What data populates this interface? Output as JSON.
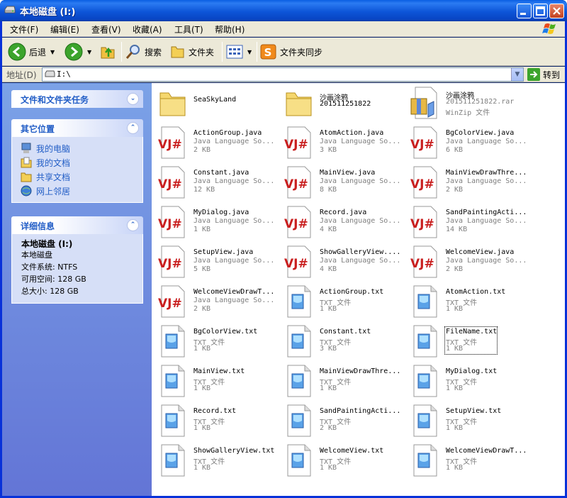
{
  "window": {
    "title": "本地磁盘 (I:)"
  },
  "menu": [
    "文件(F)",
    "编辑(E)",
    "查看(V)",
    "收藏(A)",
    "工具(T)",
    "帮助(H)"
  ],
  "toolbar": {
    "back_label": "后退",
    "search_label": "搜索",
    "folders_label": "文件夹",
    "sync_label": "文件夹同步"
  },
  "address": {
    "label": "地址(D)",
    "value": "I:\\",
    "go_label": "转到"
  },
  "left_panel": {
    "tasks_title": "文件和文件夹任务",
    "other_title": "其它位置",
    "other_links": [
      "我的电脑",
      "我的文档",
      "共享文档",
      "网上邻居"
    ],
    "details_title": "详细信息",
    "details": {
      "name": "本地磁盘 (I:)",
      "type": "本地磁盘",
      "fs": "文件系统: NTFS",
      "free": "可用空间: 128 GB",
      "total": "总大小: 128 GB"
    }
  },
  "files": [
    {
      "l1": "SeaSkyLand",
      "l2": "",
      "l3": "",
      "icon": "folder"
    },
    {
      "l1": "沙画涂鸦",
      "l2": "201511251822",
      "l3": "",
      "icon": "folder"
    },
    {
      "l1": "沙画涂鸦",
      "l2": "201511251822.rar",
      "l3": "WinZip 文件",
      "icon": "zip"
    },
    {
      "l1": "ActionGroup.java",
      "l2": "Java Language So...",
      "l3": "2 KB",
      "icon": "java"
    },
    {
      "l1": "AtomAction.java",
      "l2": "Java Language So...",
      "l3": "3 KB",
      "icon": "java"
    },
    {
      "l1": "BgColorView.java",
      "l2": "Java Language So...",
      "l3": "6 KB",
      "icon": "java"
    },
    {
      "l1": "Constant.java",
      "l2": "Java Language So...",
      "l3": "12 KB",
      "icon": "java"
    },
    {
      "l1": "MainView.java",
      "l2": "Java Language So...",
      "l3": "8 KB",
      "icon": "java"
    },
    {
      "l1": "MainViewDrawThre...",
      "l2": "Java Language So...",
      "l3": "2 KB",
      "icon": "java"
    },
    {
      "l1": "MyDialog.java",
      "l2": "Java Language So...",
      "l3": "1 KB",
      "icon": "java"
    },
    {
      "l1": "Record.java",
      "l2": "Java Language So...",
      "l3": "4 KB",
      "icon": "java"
    },
    {
      "l1": "SandPaintingActi...",
      "l2": "Java Language So...",
      "l3": "14 KB",
      "icon": "java"
    },
    {
      "l1": "SetupView.java",
      "l2": "Java Language So...",
      "l3": "5 KB",
      "icon": "java"
    },
    {
      "l1": "ShowGalleryView....",
      "l2": "Java Language So...",
      "l3": "4 KB",
      "icon": "java"
    },
    {
      "l1": "WelcomeView.java",
      "l2": "Java Language So...",
      "l3": "2 KB",
      "icon": "java"
    },
    {
      "l1": "WelcomeViewDrawT...",
      "l2": "Java Language So...",
      "l3": "2 KB",
      "icon": "java"
    },
    {
      "l1": "ActionGroup.txt",
      "l2": "TXT 文件",
      "l3": "1 KB",
      "icon": "txt"
    },
    {
      "l1": "AtomAction.txt",
      "l2": "TXT 文件",
      "l3": "1 KB",
      "icon": "txt"
    },
    {
      "l1": "BgColorView.txt",
      "l2": "TXT 文件",
      "l3": "1 KB",
      "icon": "txt"
    },
    {
      "l1": "Constant.txt",
      "l2": "TXT 文件",
      "l3": "3 KB",
      "icon": "txt"
    },
    {
      "l1": "FileName.txt",
      "l2": "TXT 文件",
      "l3": "1 KB",
      "icon": "txt",
      "focused": true
    },
    {
      "l1": "MainView.txt",
      "l2": "TXT 文件",
      "l3": "1 KB",
      "icon": "txt"
    },
    {
      "l1": "MainViewDrawThre...",
      "l2": "TXT 文件",
      "l3": "1 KB",
      "icon": "txt"
    },
    {
      "l1": "MyDialog.txt",
      "l2": "TXT 文件",
      "l3": "1 KB",
      "icon": "txt"
    },
    {
      "l1": "Record.txt",
      "l2": "TXT 文件",
      "l3": "1 KB",
      "icon": "txt"
    },
    {
      "l1": "SandPaintingActi...",
      "l2": "TXT 文件",
      "l3": "2 KB",
      "icon": "txt"
    },
    {
      "l1": "SetupView.txt",
      "l2": "TXT 文件",
      "l3": "1 KB",
      "icon": "txt"
    },
    {
      "l1": "ShowGalleryView.txt",
      "l2": "TXT 文件",
      "l3": "1 KB",
      "icon": "txt"
    },
    {
      "l1": "WelcomeView.txt",
      "l2": "TXT 文件",
      "l3": "1 KB",
      "icon": "txt"
    },
    {
      "l1": "WelcomeViewDrawT...",
      "l2": "TXT 文件",
      "l3": "1 KB",
      "icon": "txt"
    }
  ]
}
